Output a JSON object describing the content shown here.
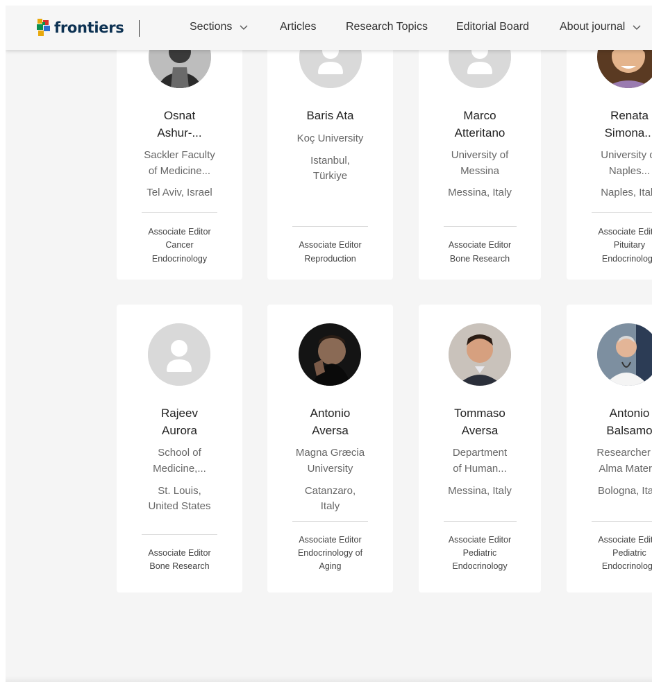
{
  "header": {
    "logo_text": "frontiers",
    "nav": [
      {
        "label": "Sections",
        "dropdown": true
      },
      {
        "label": "Articles",
        "dropdown": false
      },
      {
        "label": "Research Topics",
        "dropdown": false
      },
      {
        "label": "Editorial Board",
        "dropdown": false
      },
      {
        "label": "About journal",
        "dropdown": true
      }
    ]
  },
  "editors": [
    {
      "name1": "Osnat",
      "name2": "Ashur-...",
      "affil1": "Sackler Faculty",
      "affil2": "of Medicine...",
      "loc1": "Tel Aviv, Israel",
      "loc2": "",
      "role1": "Associate Editor",
      "role2": "Cancer",
      "role3": "Endocrinology",
      "avatar": "photo"
    },
    {
      "name1": "Baris Ata",
      "name2": "",
      "affil1": "Koç University",
      "affil2": "",
      "loc1": "Istanbul,",
      "loc2": "Türkiye",
      "role1": "Associate Editor",
      "role2": "Reproduction",
      "role3": "",
      "avatar": "placeholder"
    },
    {
      "name1": "Marco",
      "name2": "Atteritano",
      "affil1": "University of",
      "affil2": "Messina",
      "loc1": "Messina, Italy",
      "loc2": "",
      "role1": "Associate Editor",
      "role2": "Bone Research",
      "role3": "",
      "avatar": "placeholder"
    },
    {
      "name1": "Renata",
      "name2": "Simona...",
      "affil1": "University of",
      "affil2": "Naples...",
      "loc1": "Naples, Italy",
      "loc2": "",
      "role1": "Associate Editor",
      "role2": "Pituitary",
      "role3": "Endocrinology",
      "avatar": "photo"
    },
    {
      "name1": "Rajeev",
      "name2": "Aurora",
      "affil1": "School of",
      "affil2": "Medicine,...",
      "loc1": "St. Louis,",
      "loc2": "United States",
      "role1": "Associate Editor",
      "role2": "Bone Research",
      "role3": "",
      "avatar": "placeholder"
    },
    {
      "name1": "Antonio",
      "name2": "Aversa",
      "affil1": "Magna Græcia",
      "affil2": "University",
      "loc1": "Catanzaro,",
      "loc2": "Italy",
      "role1": "Associate Editor",
      "role2": "Endocrinology of",
      "role3": "Aging",
      "avatar": "photo"
    },
    {
      "name1": "Tommaso",
      "name2": "Aversa",
      "affil1": "Department",
      "affil2": "of Human...",
      "loc1": "Messina, Italy",
      "loc2": "",
      "role1": "Associate Editor",
      "role2": "Pediatric",
      "role3": "Endocrinology",
      "avatar": "photo"
    },
    {
      "name1": "Antonio",
      "name2": "Balsamo",
      "affil1": "Researcher at",
      "affil2": "Alma Mater...",
      "loc1": "Bologna, Italy",
      "loc2": "",
      "role1": "Associate Editor",
      "role2": "Pediatric",
      "role3": "Endocrinology",
      "avatar": "photo"
    }
  ]
}
